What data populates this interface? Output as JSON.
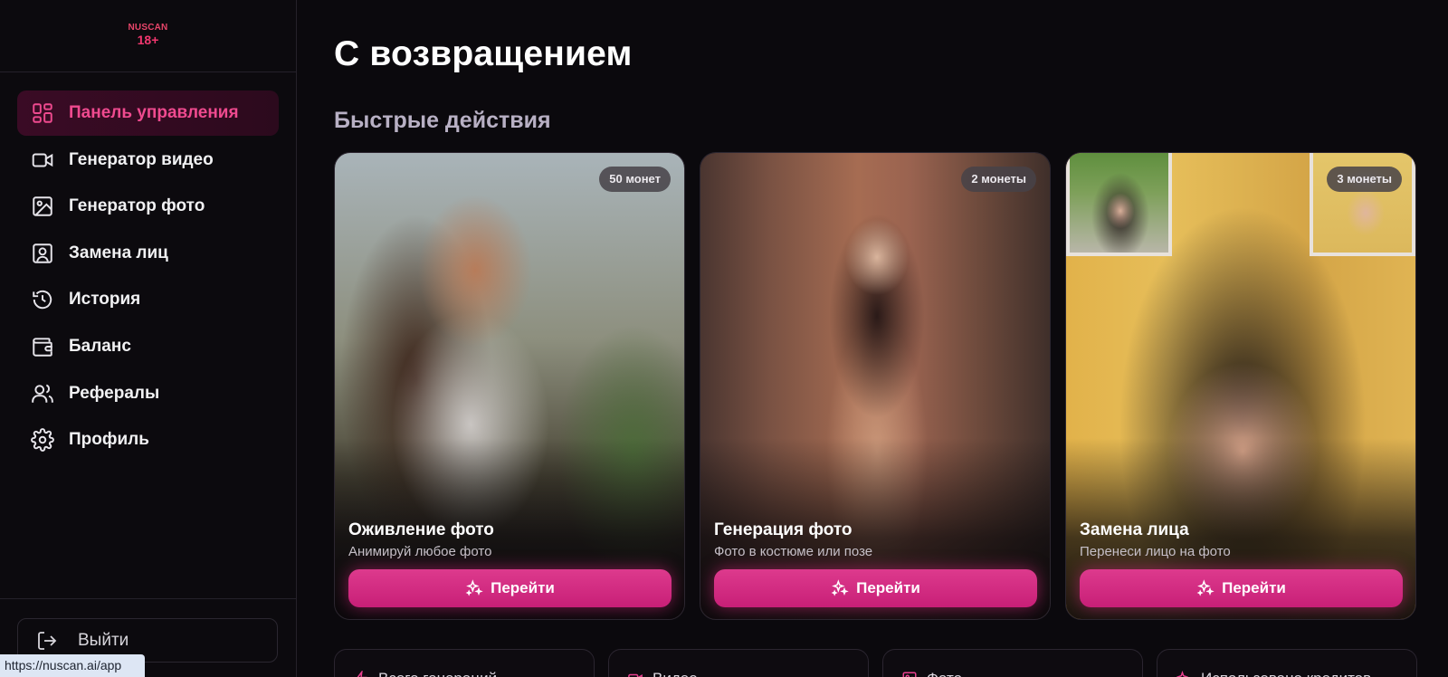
{
  "brand": {
    "logo_line1": "NUSCAN",
    "logo_line2": "18+",
    "accent": "#e8408e"
  },
  "sidebar": {
    "items": [
      {
        "label": "Панель управления",
        "icon": "dashboard-icon",
        "active": true
      },
      {
        "label": "Генератор видео",
        "icon": "video-camera-icon"
      },
      {
        "label": "Генератор фото",
        "icon": "image-icon"
      },
      {
        "label": "Замена лиц",
        "icon": "face-portrait-icon"
      },
      {
        "label": "История",
        "icon": "history-icon"
      },
      {
        "label": "Баланс",
        "icon": "wallet-icon"
      },
      {
        "label": "Рефералы",
        "icon": "users-icon"
      },
      {
        "label": "Профиль",
        "icon": "gear-icon"
      }
    ],
    "logout_label": "Выйти"
  },
  "status_bar": {
    "url": "https://nuscan.ai/app"
  },
  "main": {
    "title": "С возвращением",
    "quick_actions_title": "Быстрые действия",
    "cards": [
      {
        "title": "Оживление фото",
        "subtitle": "Анимируй любое фото",
        "badge": "50 монет",
        "button": "Перейти"
      },
      {
        "title": "Генерация фото",
        "subtitle": "Фото в костюме или позе",
        "badge": "2 монеты",
        "button": "Перейти"
      },
      {
        "title": "Замена лица",
        "subtitle": "Перенеси лицо на фото",
        "badge": "3 монеты",
        "button": "Перейти"
      }
    ],
    "stats": [
      {
        "label": "Всего генераций",
        "icon": "bolt-icon"
      },
      {
        "label": "Видео",
        "icon": "video-camera-icon"
      },
      {
        "label": "Фото",
        "icon": "image-icon"
      },
      {
        "label": "Использовано кредитов",
        "icon": "sparkle-icon"
      }
    ]
  }
}
